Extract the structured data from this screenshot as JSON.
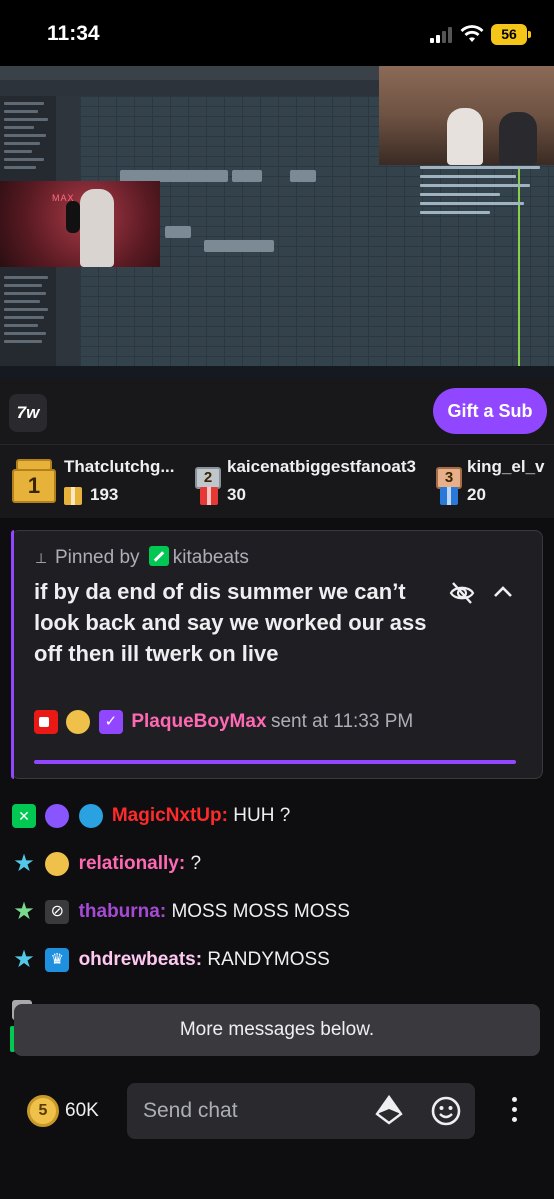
{
  "status_bar": {
    "time": "11:34",
    "battery": "56"
  },
  "video": {
    "cam_overlay_text": "MAX"
  },
  "channel_bar": {
    "logo_text": "7w",
    "gift_button": "Gift a Sub"
  },
  "leaderboard": [
    {
      "rank": "1",
      "name": "Thatclutchg...",
      "count": "193",
      "color": "#e6b23a"
    },
    {
      "rank": "2",
      "name": "kaicenatbiggestfanoat3",
      "count": "30",
      "color": "#bfc6cc"
    },
    {
      "rank": "3",
      "name": "king_el_v",
      "count": "20",
      "color": "#e7b08a"
    }
  ],
  "pinned": {
    "pinned_by_label": "Pinned by",
    "pinned_by_user": "kitabeats",
    "message": "if by da end of dis summer we can’t look back and say we worked our ass off then   ill twerk on live",
    "author": "PlaqueBoyMax",
    "sent_label": "sent at 11:33 PM",
    "author_color": "#ff69b4"
  },
  "chat": [
    {
      "user": "MagicNxtUp:",
      "text": "HUH ?",
      "color": "#ff2a2a"
    },
    {
      "user": "relationally:",
      "text": "?",
      "color": "#ff69b4"
    },
    {
      "user": "thaburna:",
      "text": "MOSS MOSS MOSS",
      "color": "#a64ad6"
    },
    {
      "user": "ohdrewbeats:",
      "text": "RANDYMOSS",
      "color": "#ffc8f0"
    }
  ],
  "more_banner": "More messages below.",
  "bottom": {
    "coin_badge": "5",
    "coin_count": "60K",
    "input_placeholder": "Send chat"
  },
  "colors": {
    "accent": "#9147ff",
    "background": "#0e0e10",
    "panel": "#18181b"
  },
  "icons": [
    "signal-icon",
    "wifi-icon",
    "battery-icon",
    "pin-icon",
    "eye-off-icon",
    "chevron-up-icon",
    "coin-icon",
    "bits-icon",
    "emote-icon",
    "more-vertical-icon"
  ]
}
